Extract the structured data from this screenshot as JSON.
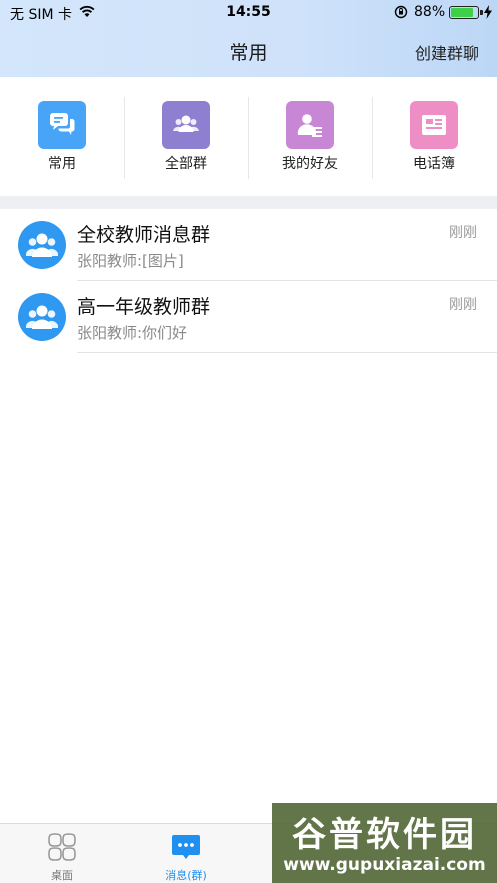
{
  "status_bar": {
    "carrier": "无 SIM 卡",
    "time": "14:55",
    "battery": "88%",
    "battery_level": 0.88
  },
  "nav": {
    "title": "常用",
    "action": "创建群聊"
  },
  "quick_access": [
    {
      "label": "常用",
      "icon": "chat-bubbles-icon",
      "color": "#48a4f7"
    },
    {
      "label": "全部群",
      "icon": "group-icon",
      "color": "#8e7fd0"
    },
    {
      "label": "我的好友",
      "icon": "friend-card-icon",
      "color": "#c887d4"
    },
    {
      "label": "电话簿",
      "icon": "phonebook-icon",
      "color": "#ef8ec4"
    }
  ],
  "conversations": [
    {
      "name": "全校教师消息群",
      "last_message": "张阳教师:[图片]",
      "time": "刚刚"
    },
    {
      "name": "高一年级教师群",
      "last_message": "张阳教师:你们好",
      "time": "刚刚"
    }
  ],
  "tabbar": {
    "tabs": [
      {
        "label": "桌面",
        "icon": "desktop-grid-icon",
        "active": false
      },
      {
        "label": "消息(群)",
        "icon": "message-icon",
        "active": true
      }
    ]
  },
  "watermark": {
    "title": "谷普软件园",
    "url": "www.gupuxiazai.com"
  },
  "colors": {
    "accent": "#1f8ff0",
    "avatar": "#2f98f0"
  }
}
